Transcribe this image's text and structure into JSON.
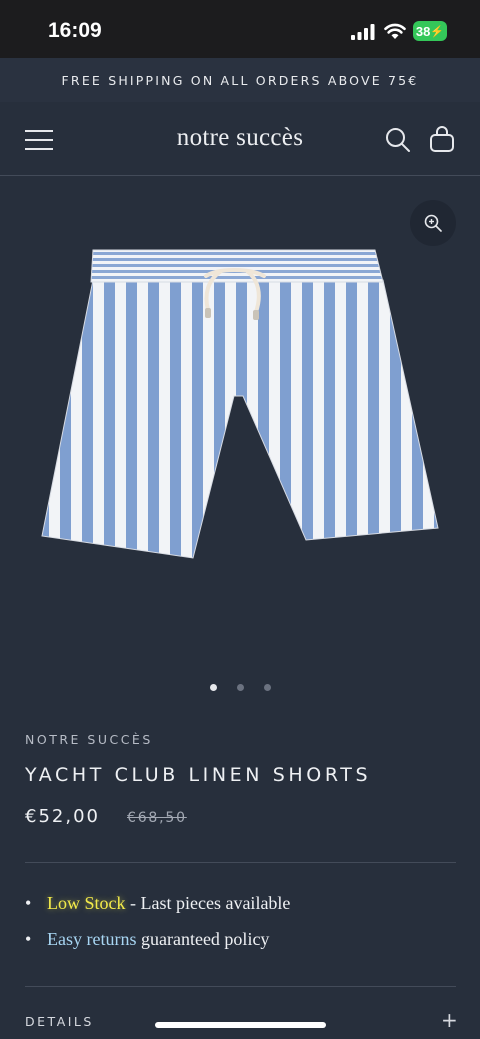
{
  "status_bar": {
    "time": "16:09",
    "battery": "38",
    "battery_color": "#34c759",
    "icons": [
      "signal-icon",
      "wifi-icon",
      "battery-charging-icon"
    ]
  },
  "announcement": {
    "text": "FREE SHIPPING ON ALL ORDERS ABOVE 75€"
  },
  "header": {
    "brand": "notre succès",
    "icons": [
      "menu-icon",
      "search-icon",
      "shopping-bag-icon"
    ]
  },
  "gallery": {
    "image_alt": "Blue and white striped linen shorts",
    "zoom_icon": "zoom-in-icon",
    "slide_count": 3,
    "active_slide": 1
  },
  "product": {
    "vendor": "NOTRE SUCCÈS",
    "title": "YACHT CLUB LINEN SHORTS",
    "price": "€52,00",
    "compare_price": "€68,50"
  },
  "highlights": [
    {
      "label": "Low Stock",
      "text": " - Last pieces available",
      "color": "#f2ea4a"
    },
    {
      "label": "Easy returns",
      "text": " guaranteed policy",
      "color": "#a8d6f3"
    }
  ],
  "details": {
    "label": "DETAILS",
    "toggle": "+"
  },
  "colors": {
    "background": "#272f3c",
    "status_bar": "#1c1c1e",
    "text": "#e6e8ec"
  }
}
